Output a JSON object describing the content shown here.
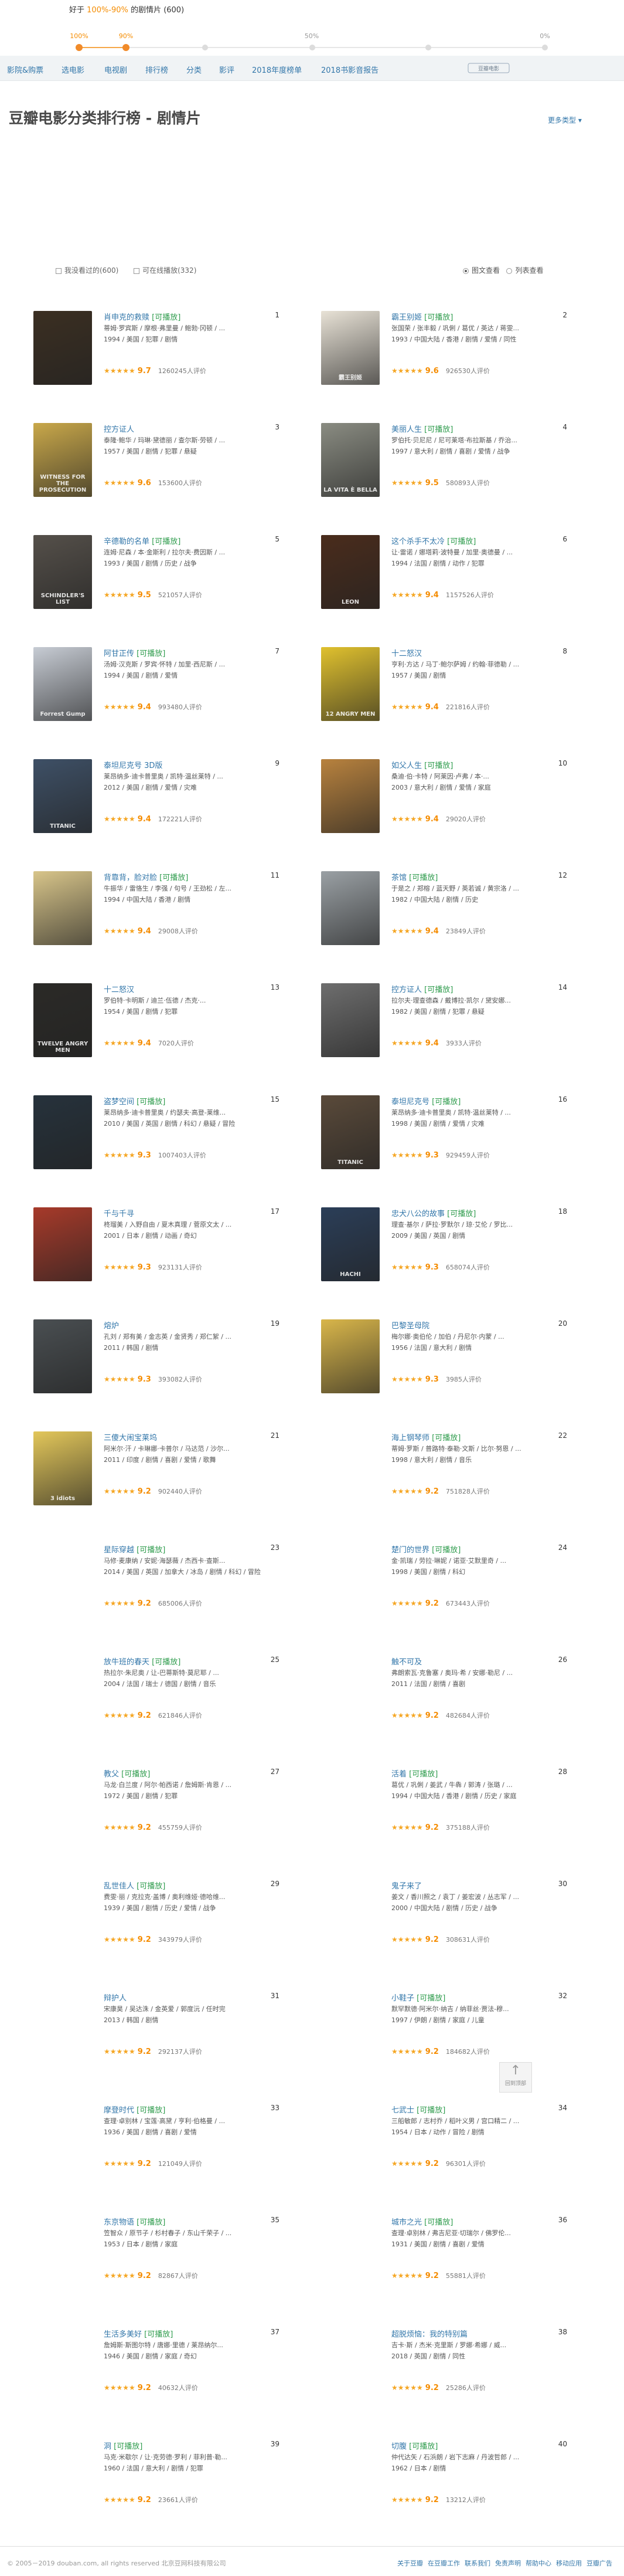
{
  "slider": {
    "title_prefix": "好于",
    "title_range": "100%-90%",
    "title_suffix": "的剧情片 (600)",
    "labels": [
      "100%",
      "90%",
      "50%",
      "0%"
    ],
    "selected_range": [
      1.0,
      0.9
    ]
  },
  "nav": {
    "items": [
      "影院&购票",
      "选电影",
      "电视剧",
      "排行榜",
      "分类",
      "影评",
      "2018年度榜单",
      "2018书影音报告"
    ],
    "logo_text": "豆瓣电影"
  },
  "page": {
    "title": "豆瓣电影分类排行榜 - 剧情片",
    "more_types": "更多类型 ▾",
    "filter_seen": "我没看过的(600)",
    "filter_playable": "可在线播放(332)",
    "view_image": "图文查看",
    "view_list": "列表查看"
  },
  "movies": [
    {
      "rank": "1",
      "title": "肖申克的救赎",
      "playable": "[可播放]",
      "cast": "蒂姆·罗宾斯 / 摩根·弗里曼 / 鲍勃·冈顿 / ...",
      "info": "1994 / 美国 / 犯罪 / 剧情",
      "stars": 5,
      "score": "9.7",
      "votes": "1260245人评价",
      "poster_color": "#3b2f22",
      "poster_text": ""
    },
    {
      "rank": "2",
      "title": "霸王别姬",
      "playable": "[可播放]",
      "cast": "张国荣 / 张丰毅 / 巩俐 / 葛优 / 英达 / 蒋雯...",
      "info": "1993 / 中国大陆 / 香港 / 剧情 / 爱情 / 同性",
      "stars": 5,
      "score": "9.6",
      "votes": "926530人评价",
      "poster_color": "#e8e2d6",
      "poster_text": "霸王别姬"
    },
    {
      "rank": "3",
      "title": "控方证人",
      "playable": "",
      "cast": "泰隆·鲍华 / 玛琳·黛德丽 / 查尔斯·劳顿 / ...",
      "info": "1957 / 美国 / 剧情 / 犯罪 / 悬疑",
      "stars": 5,
      "score": "9.6",
      "votes": "153600人评价",
      "poster_color": "#c9a84a",
      "poster_text": "WITNESS FOR THE PROSECUTION"
    },
    {
      "rank": "4",
      "title": "美丽人生",
      "playable": "[可播放]",
      "cast": "罗伯托·贝尼尼 / 尼可莱塔·布拉斯基 / 乔治...",
      "info": "1997 / 意大利 / 剧情 / 喜剧 / 爱情 / 战争",
      "stars": 5,
      "score": "9.5",
      "votes": "580893人评价",
      "poster_color": "#8a8c82",
      "poster_text": "LA VITA È BELLA"
    },
    {
      "rank": "5",
      "title": "辛德勒的名单",
      "playable": "[可播放]",
      "cast": "连姆·尼森 / 本·金斯利 / 拉尔夫·费因斯 / ...",
      "info": "1993 / 美国 / 剧情 / 历史 / 战争",
      "stars": 5,
      "score": "9.5",
      "votes": "521057人评价",
      "poster_color": "#55504a",
      "poster_text": "SCHINDLER'S LIST"
    },
    {
      "rank": "6",
      "title": "这个杀手不太冷",
      "playable": "[可播放]",
      "cast": "让·雷诺 / 娜塔莉·波特曼 / 加里·奥德曼 / ...",
      "info": "1994 / 法国 / 剧情 / 动作 / 犯罪",
      "stars": 5,
      "score": "9.4",
      "votes": "1157526人评价",
      "poster_color": "#4a2c1c",
      "poster_text": "LEON"
    },
    {
      "rank": "7",
      "title": "阿甘正传",
      "playable": "[可播放]",
      "cast": "汤姆·汉克斯 / 罗宾·怀特 / 加里·西尼斯 / ...",
      "info": "1994 / 美国 / 剧情 / 爱情",
      "stars": 5,
      "score": "9.4",
      "votes": "993480人评价",
      "poster_color": "#c7ccd4",
      "poster_text": "Forrest Gump"
    },
    {
      "rank": "8",
      "title": "十二怒汉",
      "playable": "",
      "cast": "亨利·方达 / 马丁·鲍尔萨姆 / 约翰·菲德勒 / ...",
      "info": "1957 / 美国 / 剧情",
      "stars": 5,
      "score": "9.4",
      "votes": "221816人评价",
      "poster_color": "#e0c12e",
      "poster_text": "12 ANGRY MEN"
    },
    {
      "rank": "9",
      "title": "泰坦尼克号 3D版",
      "playable": "",
      "cast": "莱昂纳多·迪卡普里奥 / 凯特·温丝莱特 / ...",
      "info": "2012 / 美国 / 剧情 / 爱情 / 灾难",
      "stars": 5,
      "score": "9.4",
      "votes": "172221人评价",
      "poster_color": "#3e5066",
      "poster_text": "TITANIC"
    },
    {
      "rank": "10",
      "title": "如父人生",
      "playable": "[可播放]",
      "cast": "桑迪·伯·卡特 / 阿莱因·卢弗 / 本·...",
      "info": "2003 / 意大利 / 剧情 / 爱情 / 家庭",
      "stars": 5,
      "score": "9.4",
      "votes": "29020人评价",
      "poster_color": "#b8823e",
      "poster_text": ""
    },
    {
      "rank": "11",
      "title": "背靠背，脸对脸",
      "playable": "[可播放]",
      "cast": "牛振华 / 雷恪生 / 李强 / 句号 / 王劲松 / 左...",
      "info": "1994 / 中国大陆 / 香港 / 剧情",
      "stars": 5,
      "score": "9.4",
      "votes": "29008人评价",
      "poster_color": "#d8c58a",
      "poster_text": ""
    },
    {
      "rank": "12",
      "title": "茶馆",
      "playable": "[可播放]",
      "cast": "于是之 / 郑榕 / 蓝天野 / 英若诚 / 黄宗洛 / ...",
      "info": "1982 / 中国大陆 / 剧情 / 历史",
      "stars": 5,
      "score": "9.4",
      "votes": "23849人评价",
      "poster_color": "#9aa0a4",
      "poster_text": ""
    },
    {
      "rank": "13",
      "title": "十二怒汉",
      "playable": "",
      "cast": "罗伯特·卡明斯 / 迪兰·伍德 / 杰克·...",
      "info": "1954 / 美国 / 剧情 / 犯罪",
      "stars": 5,
      "score": "9.4",
      "votes": "7020人评价",
      "poster_color": "#2b2a27",
      "poster_text": "TWELVE ANGRY MEN"
    },
    {
      "rank": "14",
      "title": "控方证人",
      "playable": "[可播放]",
      "cast": "拉尔夫·理查德森 / 戴博拉·凯尔 / 黛安娜...",
      "info": "1982 / 美国 / 剧情 / 犯罪 / 悬疑",
      "stars": 5,
      "score": "9.4",
      "votes": "3933人评价",
      "poster_color": "#6e6e6e",
      "poster_text": ""
    },
    {
      "rank": "15",
      "title": "盗梦空间",
      "playable": "[可播放]",
      "cast": "莱昂纳多·迪卡普里奥 / 约瑟夫·高登-莱维...",
      "info": "2010 / 美国 / 英国 / 剧情 / 科幻 / 悬疑 / 冒险",
      "stars": 5,
      "score": "9.3",
      "votes": "1007403人评价",
      "poster_color": "#26323c",
      "poster_text": ""
    },
    {
      "rank": "16",
      "title": "泰坦尼克号",
      "playable": "[可播放]",
      "cast": "莱昂纳多·迪卡普里奥 / 凯特·温丝莱特 / ...",
      "info": "1998 / 美国 / 剧情 / 爱情 / 灾难",
      "stars": 5,
      "score": "9.3",
      "votes": "929459人评价",
      "poster_color": "#5a4a3a",
      "poster_text": "TITANIC"
    },
    {
      "rank": "17",
      "title": "千与千寻",
      "playable": "",
      "cast": "柊瑠美 / 入野自由 / 夏木真理 / 菅原文太 / ...",
      "info": "2001 / 日本 / 剧情 / 动画 / 奇幻",
      "stars": 5,
      "score": "9.3",
      "votes": "923131人评价",
      "poster_color": "#a73a2a",
      "poster_text": ""
    },
    {
      "rank": "18",
      "title": "忠犬八公的故事",
      "playable": "[可播放]",
      "cast": "理查·基尔 / 萨拉·罗默尔 / 琼·艾伦 / 罗比...",
      "info": "2009 / 美国 / 英国 / 剧情",
      "stars": 5,
      "score": "9.3",
      "votes": "658074人评价",
      "poster_color": "#2b3e58",
      "poster_text": "HACHI"
    },
    {
      "rank": "19",
      "title": "熔炉",
      "playable": "",
      "cast": "孔刘 / 郑有美 / 金志英 / 金贤秀 / 郑仁絮 / ...",
      "info": "2011 / 韩国 / 剧情",
      "stars": 5,
      "score": "9.3",
      "votes": "393082人评价",
      "poster_color": "#4a4f52",
      "poster_text": ""
    },
    {
      "rank": "20",
      "title": "巴黎圣母院",
      "playable": "",
      "cast": "梅尔娜·奥伯伦 / 加伯 / 丹尼尔·内蒙 / ...",
      "info": "1956 / 法国 / 意大利 / 剧情",
      "stars": 5,
      "score": "9.3",
      "votes": "3985人评价",
      "poster_color": "#d9b64a",
      "poster_text": ""
    },
    {
      "rank": "21",
      "title": "三傻大闹宝莱坞",
      "playable": "",
      "cast": "阿米尔·汗 / 卡琳娜·卡普尔 / 马达范 / 沙尔...",
      "info": "2011 / 印度 / 剧情 / 喜剧 / 爱情 / 歌舞",
      "stars": 5,
      "score": "9.2",
      "votes": "902440人评价",
      "poster_color": "#e3c75a",
      "poster_text": "3 idiots"
    },
    {
      "rank": "22",
      "title": "海上钢琴师",
      "playable": "[可播放]",
      "cast": "蒂姆·罗斯 / 普路特·泰勒·文斯 / 比尔·努恩 / ...",
      "info": "1998 / 意大利 / 剧情 / 音乐",
      "stars": 5,
      "score": "9.2",
      "votes": "751828人评价",
      "poster_color": "",
      "poster_text": ""
    },
    {
      "rank": "23",
      "title": "星际穿越",
      "playable": "[可播放]",
      "cast": "马修·麦康纳 / 安妮·海瑟薇 / 杰西卡·查斯...",
      "info": "2014 / 美国 / 英国 / 加拿大 / 冰岛 / 剧情 / 科幻 / 冒险",
      "stars": 5,
      "score": "9.2",
      "votes": "685006人评价",
      "poster_color": "",
      "poster_text": ""
    },
    {
      "rank": "24",
      "title": "楚门的世界",
      "playable": "[可播放]",
      "cast": "金·凯瑞 / 劳拉·琳妮 / 诺亚·艾默里奇 / ...",
      "info": "1998 / 美国 / 剧情 / 科幻",
      "stars": 5,
      "score": "9.2",
      "votes": "673443人评价",
      "poster_color": "",
      "poster_text": ""
    },
    {
      "rank": "25",
      "title": "放牛班的春天",
      "playable": "[可播放]",
      "cast": "热拉尔·朱尼奥 / 让-巴蒂斯特·莫尼耶 / ...",
      "info": "2004 / 法国 / 瑞士 / 德国 / 剧情 / 音乐",
      "stars": 5,
      "score": "9.2",
      "votes": "621846人评价",
      "poster_color": "",
      "poster_text": ""
    },
    {
      "rank": "26",
      "title": "触不可及",
      "playable": "",
      "cast": "弗朗索瓦·克鲁塞 / 奥玛·希 / 安娜·勒尼 / ...",
      "info": "2011 / 法国 / 剧情 / 喜剧",
      "stars": 5,
      "score": "9.2",
      "votes": "482684人评价",
      "poster_color": "",
      "poster_text": ""
    },
    {
      "rank": "27",
      "title": "教父",
      "playable": "[可播放]",
      "cast": "马龙·白兰度 / 阿尔·帕西诺 / 詹姆斯·肯恩 / ...",
      "info": "1972 / 美国 / 剧情 / 犯罪",
      "stars": 5,
      "score": "9.2",
      "votes": "455759人评价",
      "poster_color": "",
      "poster_text": ""
    },
    {
      "rank": "28",
      "title": "活着",
      "playable": "[可播放]",
      "cast": "葛优 / 巩俐 / 姜武 / 牛犇 / 郭涛 / 张璐 / ...",
      "info": "1994 / 中国大陆 / 香港 / 剧情 / 历史 / 家庭",
      "stars": 5,
      "score": "9.2",
      "votes": "375188人评价",
      "poster_color": "",
      "poster_text": ""
    },
    {
      "rank": "29",
      "title": "乱世佳人",
      "playable": "[可播放]",
      "cast": "费雯·丽 / 克拉克·盖博 / 奥利维娅·德哈维...",
      "info": "1939 / 美国 / 剧情 / 历史 / 爱情 / 战争",
      "stars": 5,
      "score": "9.2",
      "votes": "343979人评价",
      "poster_color": "",
      "poster_text": ""
    },
    {
      "rank": "30",
      "title": "鬼子来了",
      "playable": "",
      "cast": "姜文 / 香川照之 / 袁丁 / 姜宏波 / 丛志军 / ...",
      "info": "2000 / 中国大陆 / 剧情 / 历史 / 战争",
      "stars": 5,
      "score": "9.2",
      "votes": "308631人评价",
      "poster_color": "",
      "poster_text": ""
    },
    {
      "rank": "31",
      "title": "辩护人",
      "playable": "",
      "cast": "宋康昊 / 吴达洙 / 金英爱 / 郭度沅 / 任时完",
      "info": "2013 / 韩国 / 剧情",
      "stars": 5,
      "score": "9.2",
      "votes": "292137人评价",
      "poster_color": "",
      "poster_text": ""
    },
    {
      "rank": "32",
      "title": "小鞋子",
      "playable": "[可播放]",
      "cast": "默罕默德·阿米尔·纳吉 / 纳菲丝·贾法-穆...",
      "info": "1997 / 伊朗 / 剧情 / 家庭 / 儿童",
      "stars": 5,
      "score": "9.2",
      "votes": "184682人评价",
      "poster_color": "",
      "poster_text": ""
    },
    {
      "rank": "33",
      "title": "摩登时代",
      "playable": "[可播放]",
      "cast": "查理·卓别林 / 宝莲·高黛 / 亨利·伯格曼 / ...",
      "info": "1936 / 美国 / 剧情 / 喜剧 / 爱情",
      "stars": 5,
      "score": "9.2",
      "votes": "121049人评价",
      "poster_color": "",
      "poster_text": ""
    },
    {
      "rank": "34",
      "title": "七武士",
      "playable": "[可播放]",
      "cast": "三船敏郎 / 志村乔 / 稻叶义男 / 宫口精二 / ...",
      "info": "1954 / 日本 / 动作 / 冒险 / 剧情",
      "stars": 5,
      "score": "9.2",
      "votes": "96301人评价",
      "poster_color": "",
      "poster_text": ""
    },
    {
      "rank": "35",
      "title": "东京物语",
      "playable": "[可播放]",
      "cast": "笠智众 / 原节子 / 杉村春子 / 东山千荣子 / ...",
      "info": "1953 / 日本 / 剧情 / 家庭",
      "stars": 5,
      "score": "9.2",
      "votes": "82867人评价",
      "poster_color": "",
      "poster_text": ""
    },
    {
      "rank": "36",
      "title": "城市之光",
      "playable": "[可播放]",
      "cast": "查理·卓别林 / 弗吉尼亚·切瑞尔 / 佛罗伦...",
      "info": "1931 / 美国 / 剧情 / 喜剧 / 爱情",
      "stars": 5,
      "score": "9.2",
      "votes": "55881人评价",
      "poster_color": "",
      "poster_text": ""
    },
    {
      "rank": "37",
      "title": "生活多美好",
      "playable": "[可播放]",
      "cast": "詹姆斯·斯图尔特 / 唐娜·里德 / 莱昂纳尔...",
      "info": "1946 / 美国 / 剧情 / 家庭 / 奇幻",
      "stars": 5,
      "score": "9.2",
      "votes": "40632人评价",
      "poster_color": "",
      "poster_text": ""
    },
    {
      "rank": "38",
      "title": "超脱烦恼：我的特别篇",
      "playable": "",
      "cast": "吉卡·斯 / 杰米·克里斯 / 罗娜·希娜 / 威...",
      "info": "2018 / 英国 / 剧情 / 同性",
      "stars": 5,
      "score": "9.2",
      "votes": "25286人评价",
      "poster_color": "",
      "poster_text": ""
    },
    {
      "rank": "39",
      "title": "洞",
      "playable": "[可播放]",
      "cast": "马克·米歇尔 / 让·克劳德·罗利 / 菲利普·勒...",
      "info": "1960 / 法国 / 意大利 / 剧情 / 犯罪",
      "stars": 5,
      "score": "9.2",
      "votes": "23661人评价",
      "poster_color": "",
      "poster_text": ""
    },
    {
      "rank": "40",
      "title": "切腹",
      "playable": "[可播放]",
      "cast": "仲代达矢 / 石浜朗 / 岩下志麻 / 丹波哲郎 / ...",
      "info": "1962 / 日本 / 剧情",
      "stars": 5,
      "score": "9.2",
      "votes": "13212人评价",
      "poster_color": "",
      "poster_text": ""
    }
  ],
  "backtop": {
    "label": "回到顶部"
  },
  "footer": {
    "copyright": "© 2005－2019 douban.com, all rights reserved 北京豆网科技有限公司",
    "links": [
      "关于豆瓣",
      "在豆瓣工作",
      "联系我们",
      "免责声明",
      "帮助中心",
      "移动应用",
      "豆瓣广告"
    ]
  },
  "colors": {
    "accent": "#37a",
    "orange": "#f58c00",
    "playable": "#2f9c4d"
  }
}
